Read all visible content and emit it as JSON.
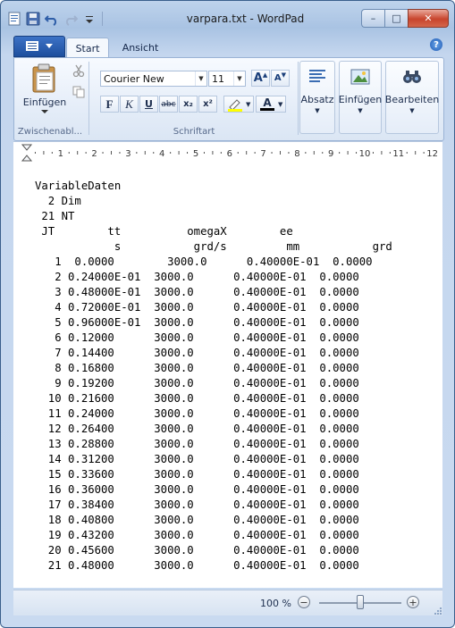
{
  "window": {
    "title": "varpara.txt - WordPad",
    "controls": {
      "minimize": "–",
      "maximize": "□",
      "close": "✕"
    }
  },
  "quick_access": {
    "icons": [
      "app-doc-icon",
      "save-icon",
      "undo-icon",
      "redo-icon",
      "customize-dropdown-icon"
    ]
  },
  "tabs": {
    "start": "Start",
    "view": "Ansicht",
    "help": "?"
  },
  "ribbon": {
    "clipboard": {
      "paste_label": "Einfügen",
      "group_label": "Zwischenabl..."
    },
    "font": {
      "family": "Courier New",
      "size": "11",
      "grow": "A",
      "shrink": "A",
      "bold": "F",
      "italic": "K",
      "underline": "U",
      "strike": "abc",
      "subscript": "x₂",
      "superscript": "x²",
      "color_letter": "A",
      "group_label": "Schriftart",
      "highlight_color": "#ffff00",
      "text_color": "#000000"
    },
    "paragraph": {
      "label": "Absatz"
    },
    "insert": {
      "label": "Einfügen"
    },
    "editing": {
      "label": "Bearbeiten"
    }
  },
  "ruler": {
    "numbers": [
      "1",
      "2",
      "3",
      "4",
      "5",
      "6",
      "7",
      "8",
      "9",
      "10",
      "11",
      "12"
    ]
  },
  "document": {
    "lines": [
      "VariableDaten",
      "  2 Dim",
      " 21 NT",
      " JT        tt          omegaX        ee",
      "            s           grd/s         mm           grd",
      "   1  0.0000        3000.0      0.40000E-01  0.0000",
      "   2 0.24000E-01  3000.0      0.40000E-01  0.0000",
      "   3 0.48000E-01  3000.0      0.40000E-01  0.0000",
      "   4 0.72000E-01  3000.0      0.40000E-01  0.0000",
      "   5 0.96000E-01  3000.0      0.40000E-01  0.0000",
      "   6 0.12000      3000.0      0.40000E-01  0.0000",
      "   7 0.14400      3000.0      0.40000E-01  0.0000",
      "   8 0.16800      3000.0      0.40000E-01  0.0000",
      "   9 0.19200      3000.0      0.40000E-01  0.0000",
      "  10 0.21600      3000.0      0.40000E-01  0.0000",
      "  11 0.24000      3000.0      0.40000E-01  0.0000",
      "  12 0.26400      3000.0      0.40000E-01  0.0000",
      "  13 0.28800      3000.0      0.40000E-01  0.0000",
      "  14 0.31200      3000.0      0.40000E-01  0.0000",
      "  15 0.33600      3000.0      0.40000E-01  0.0000",
      "  16 0.36000      3000.0      0.40000E-01  0.0000",
      "  17 0.38400      3000.0      0.40000E-01  0.0000",
      "  18 0.40800      3000.0      0.40000E-01  0.0000",
      "  19 0.43200      3000.0      0.40000E-01  0.0000",
      "  20 0.45600      3000.0      0.40000E-01  0.0000",
      "  21 0.48000      3000.0      0.40000E-01  0.0000"
    ]
  },
  "statusbar": {
    "zoom": "100 %",
    "zoom_out": "−",
    "zoom_in": "+",
    "zoom_level": 1.0
  }
}
